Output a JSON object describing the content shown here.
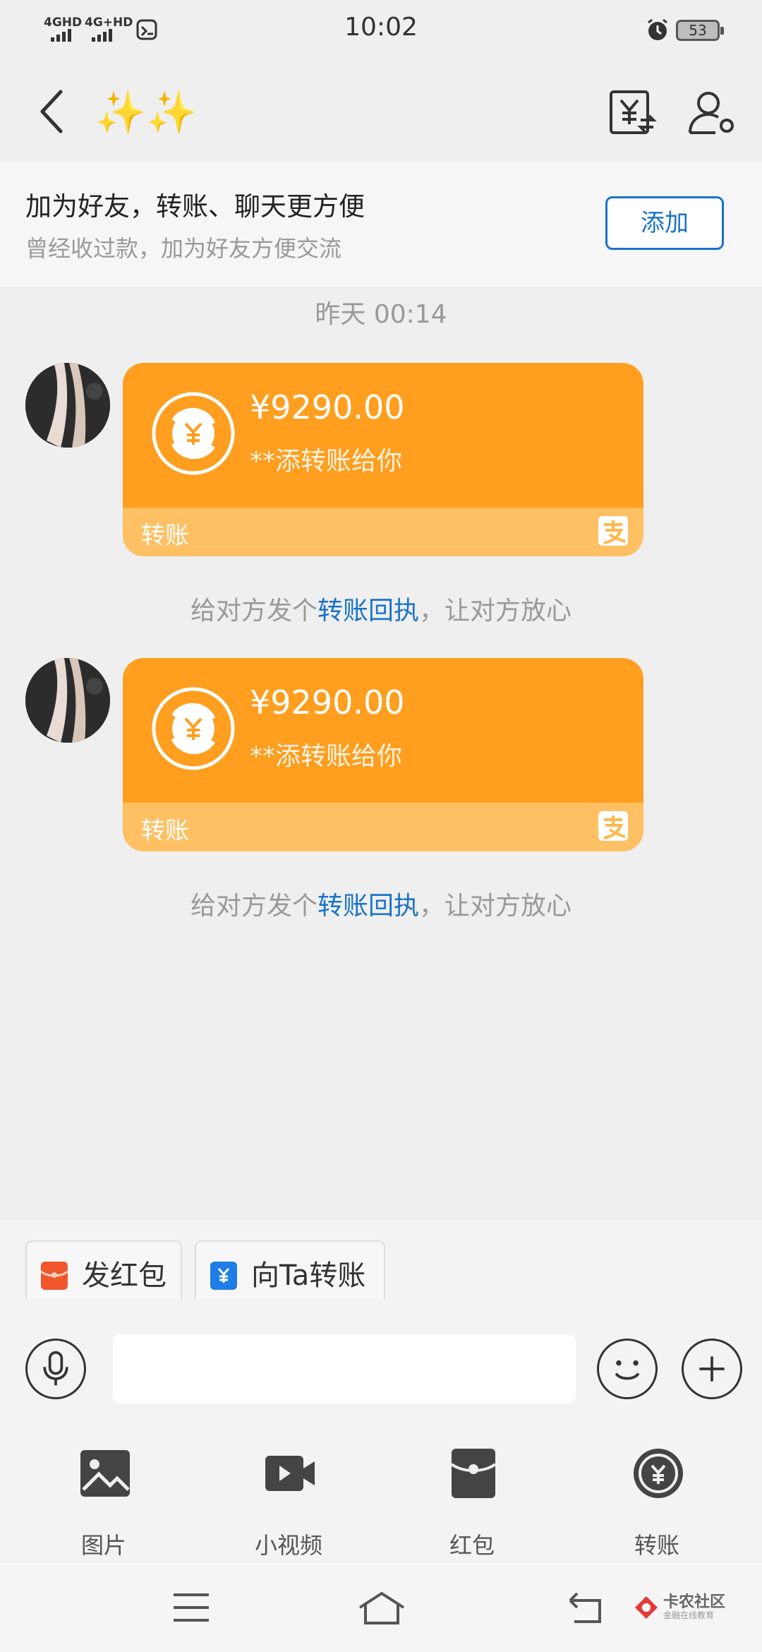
{
  "status_bar": {
    "net1": "4GHD",
    "net2": "4G+HD",
    "time": "10:02",
    "battery": "53"
  },
  "nav": {
    "title": "✨✨"
  },
  "friend_banner": {
    "title": "加为好友，转账、聊天更方便",
    "subtitle": "曾经收过款，加为好友方便交流",
    "add_button": "添加"
  },
  "chat": {
    "timestamp": "昨天 00:14",
    "messages": [
      {
        "amount": "¥9290.00",
        "description": "**添转账给你",
        "label": "转账",
        "receipt_prefix": "给对方发个",
        "receipt_link": "转账回执",
        "receipt_suffix": "，让对方放心"
      },
      {
        "amount": "¥9290.00",
        "description": "**添转账给你",
        "label": "转账",
        "receipt_prefix": "给对方发个",
        "receipt_link": "转账回执",
        "receipt_suffix": "，让对方放心"
      }
    ]
  },
  "quick_actions": [
    {
      "label": "发红包",
      "icon": "red-packet-icon",
      "color": "#f2572b"
    },
    {
      "label": "向Ta转账",
      "icon": "transfer-icon",
      "color": "#1e7de6"
    }
  ],
  "input": {
    "value": "",
    "placeholder": ""
  },
  "tools": [
    {
      "label": "图片",
      "icon": "image-icon"
    },
    {
      "label": "小视频",
      "icon": "video-icon"
    },
    {
      "label": "红包",
      "icon": "red-packet-icon"
    },
    {
      "label": "转账",
      "icon": "transfer-icon"
    }
  ],
  "watermark": {
    "title": "卡农社区",
    "subtitle": "金融在线教育"
  },
  "colors": {
    "bubble": "#ff9e1f",
    "bubble_footer": "#ffc063",
    "link": "#1a73c8",
    "background": "#efefef"
  }
}
